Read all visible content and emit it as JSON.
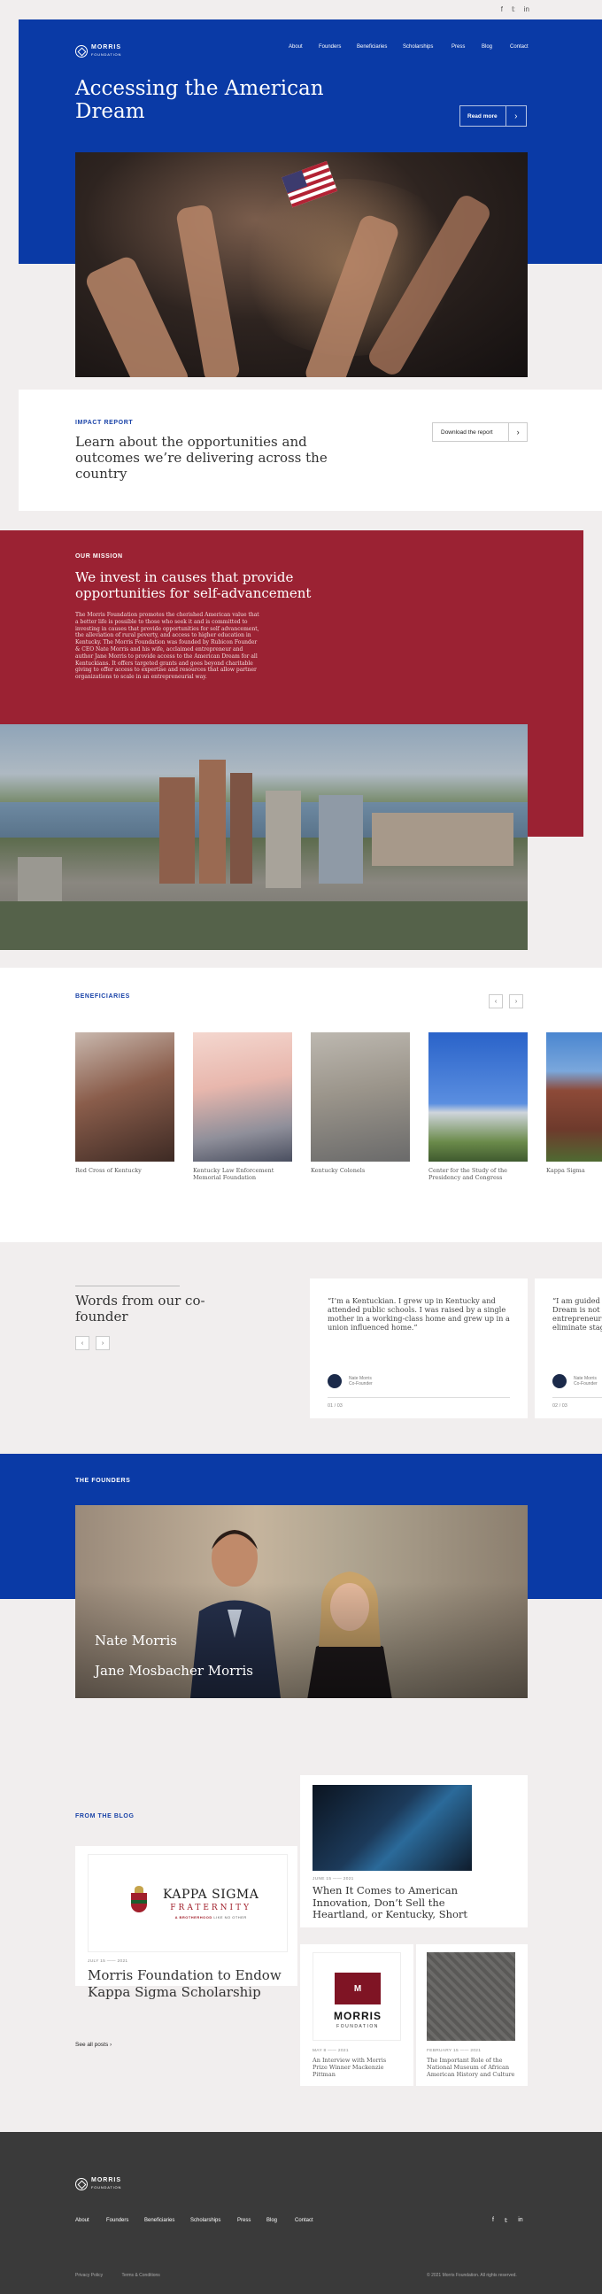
{
  "social": {
    "items": [
      {
        "icon": "facebook-icon",
        "glyph": "f"
      },
      {
        "icon": "twitter-icon",
        "glyph": "𝕥"
      },
      {
        "icon": "linkedin-icon",
        "glyph": "in"
      }
    ]
  },
  "logo": {
    "name": "MORRIS",
    "sub": "FOUNDATION"
  },
  "nav": [
    "About",
    "Founders",
    "Beneficiaries",
    "Scholarships",
    "Press",
    "Blog",
    "Contact"
  ],
  "hero": {
    "title": "Accessing the American Dream",
    "button": "Read more"
  },
  "impact": {
    "eyebrow": "IMPACT REPORT",
    "title": "Learn about the opportunities and outcomes we’re delivering across the country",
    "button": "Download the report"
  },
  "mission": {
    "eyebrow": "OUR MISSION",
    "title": "We invest in causes that provide opportunities for self-advancement",
    "body": "The Morris Foundation promotes the cherished American value that a better life is possible to those who seek it and is committed to investing in causes that provide opportunities for self advancement, the alleviation of rural poverty, and access to higher education in Kentucky. The Morris Foundation was founded by Rubicon Founder & CEO Nate Morris and his wife, acclaimed entrepreneur and author Jane Morris to provide access to the American Dream for all Kentuckians. It offers targeted grants and goes beyond charitable giving to offer access to expertise and resources that allow partner organizations to scale in an entrepreneurial way."
  },
  "beneficiaries": {
    "eyebrow": "BENEFICIARIES",
    "items": [
      {
        "label": "Red Cross of Kentucky"
      },
      {
        "label": "Kentucky Law Enforcement Memorial Foundation"
      },
      {
        "label": "Kentucky Colonels"
      },
      {
        "label": "Center for the Study of the Presidency and Congress"
      },
      {
        "label": "Kappa Sigma"
      }
    ]
  },
  "words": {
    "title": "Words from our co-founder",
    "quotes": [
      {
        "text": "“I’m a Kentuckian. I grew up in Kentucky and attended public schools. I was raised by a single mother in a working-class home and grew up in a union influenced home.”",
        "name": "Nate Morris",
        "role": "Co-Founder",
        "page": "01 / 03"
      },
      {
        "text": "“I am guided by a simple belief—the American Dream is not flaw. At the core of entrepreneurship is the idea that a person can eliminate stagnation.”",
        "name": "Nate Morris",
        "role": "Co-Founder",
        "page": "02 / 03"
      }
    ]
  },
  "founders": {
    "eyebrow": "THE FOUNDERS",
    "names": [
      "Nate Morris",
      "Jane Mosbacher Morris"
    ]
  },
  "blog": {
    "eyebrow": "FROM THE BLOG",
    "see_all": "See all posts",
    "featured": {
      "date": "JULY 15 —— 2021",
      "title": "Morris Foundation to Endow Kappa Sigma Scholarship",
      "logo_title": "KAPPA SIGMA",
      "logo_sub": "FRATERNITY",
      "logo_tag_a": "A BROTHERHOOD",
      "logo_tag_b": "LIKE NO OTHER"
    },
    "top_right": {
      "date": "JUNE 15 —— 2021",
      "title": "When It Comes to American Innovation, Don’t Sell the Heartland, or Kentucky, Short"
    },
    "bottom_1": {
      "date": "MAY 8 —— 2021",
      "title": "An Interview with Morris Prize Winner Mackenzie Pittman",
      "logo_mark": "M",
      "logo_word": "MORRIS",
      "logo_sub": "FOUNDATION"
    },
    "bottom_2": {
      "date": "FEBRUARY 15 —— 2021",
      "title": "The Important Role of the National Museum of African American History and Culture"
    }
  },
  "footer": {
    "nav": [
      "About",
      "Founders",
      "Beneficiaries",
      "Scholarships",
      "Press",
      "Blog",
      "Contact"
    ],
    "privacy": "Privacy Policy",
    "terms": "Terms & Conditions",
    "copyright": "© 2021 Morris Foundation. All rights reserved."
  }
}
